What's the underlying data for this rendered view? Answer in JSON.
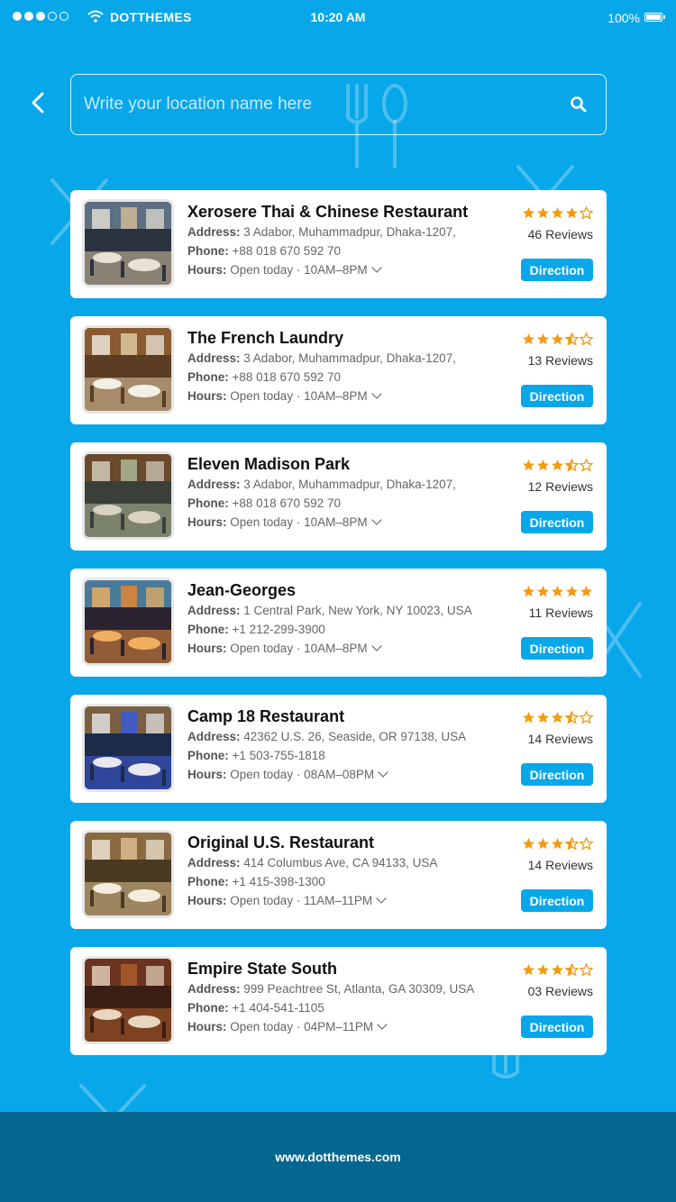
{
  "status_bar": {
    "signal_dots": [
      true,
      true,
      true,
      false,
      false
    ],
    "carrier": "DOTTHEMES",
    "time": "10:20 AM",
    "battery": "100%"
  },
  "search": {
    "placeholder": "Write your location name here",
    "value": ""
  },
  "labels": {
    "address": "Address:",
    "phone": "Phone:",
    "hours": "Hours:",
    "direction": "Direction"
  },
  "restaurants": [
    {
      "name": "Xerosere Thai & Chinese Restaurant",
      "address": "3 Adabor, Muhammadpur, Dhaka-1207,",
      "phone": "+88 018 670 592 70",
      "hours": "Open today · 10AM–8PM",
      "rating": 4,
      "reviews": "46 Reviews"
    },
    {
      "name": "The French Laundry",
      "address": "3 Adabor, Muhammadpur, Dhaka-1207,",
      "phone": "+88 018 670 592 70",
      "hours": "Open today · 10AM–8PM",
      "rating": 3.5,
      "reviews": "13 Reviews"
    },
    {
      "name": "Eleven Madison Park",
      "address": "3 Adabor, Muhammadpur, Dhaka-1207,",
      "phone": "+88 018 670 592 70",
      "hours": "Open today · 10AM–8PM",
      "rating": 3.5,
      "reviews": "12 Reviews"
    },
    {
      "name": "Jean-Georges",
      "address": "1 Central Park, New York, NY 10023, USA",
      "phone": "+1 212-299-3900",
      "hours": "Open today · 10AM–8PM",
      "rating": 5,
      "reviews": "11 Reviews"
    },
    {
      "name": "Camp 18 Restaurant",
      "address": "42362 U.S. 26, Seaside, OR 97138, USA",
      "phone": "+1 503-755-1818",
      "hours": "Open today · 08AM–08PM",
      "rating": 3.5,
      "reviews": "14 Reviews"
    },
    {
      "name": "Original U.S. Restaurant",
      "address": "414 Columbus Ave, CA 94133, USA",
      "phone": "+1 415-398-1300",
      "hours": "Open today · 11AM–11PM",
      "rating": 3.5,
      "reviews": "14 Reviews"
    },
    {
      "name": "Empire State South",
      "address": "999 Peachtree St, Atlanta, GA 30309, USA",
      "phone": "+1 404-541-1105",
      "hours": "Open today · 04PM–11PM",
      "rating": 3.5,
      "reviews": "03 Reviews"
    }
  ],
  "footer": {
    "url": "www.dotthemes.com"
  },
  "colors": {
    "background": "#07a7ea",
    "accent": "#07a7ea",
    "star": "#f39a10",
    "footer": "#05668f"
  },
  "icons": {
    "back": "chevron-left-icon",
    "search": "search-icon",
    "wifi": "wifi-icon",
    "battery": "battery-icon",
    "star_full": "star-icon",
    "star_half": "star-half-icon",
    "star_empty": "star-outline-icon",
    "hours_toggle": "chevron-down-icon",
    "background_pattern": "fork-spoon-pattern"
  }
}
